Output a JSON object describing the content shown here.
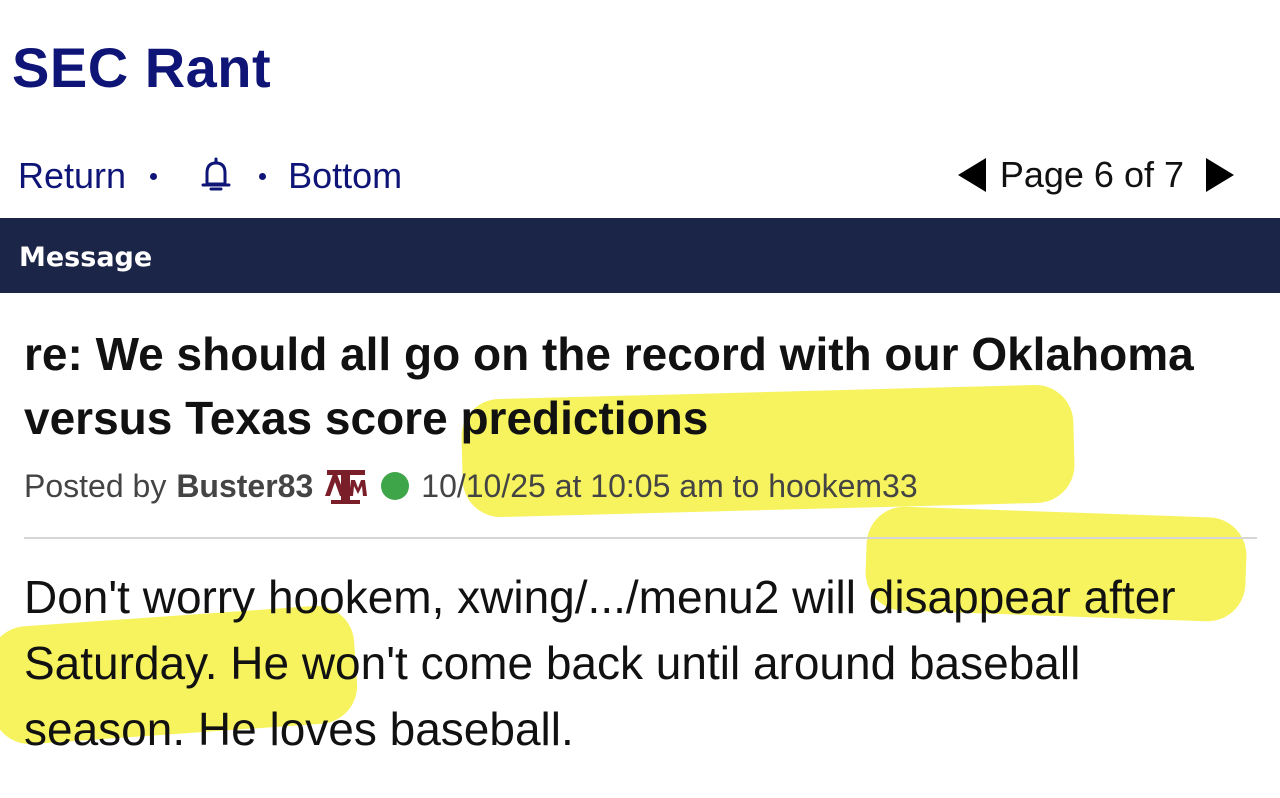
{
  "site": {
    "title": "SEC Rant"
  },
  "nav": {
    "return_label": "Return",
    "bell_icon": "bell-icon",
    "bottom_label": "Bottom"
  },
  "pager": {
    "label": "Page 6 of 7",
    "current_page": 6,
    "total_pages": 7
  },
  "section": {
    "label": "Message"
  },
  "post": {
    "title": "re: We should all go on the record with our Oklahoma versus Texas score predictions",
    "posted_by_label": "Posted by",
    "author": "Buster83",
    "team_logo": "texas-am-logo",
    "team_logo_text": "ATM",
    "online_status": "online",
    "timestamp": "10/10/25 at 10:05 am to hookem33",
    "body": "Don't worry hookem, xwing/.../menu2 will disappear after Saturday. He won't come back until around baseball season. He loves baseball."
  },
  "colors": {
    "brand": "#0e1577",
    "section_bar": "#1b2547",
    "online": "#3ea548",
    "highlight": "#f5f03a",
    "team_logo": "#7a1e2a"
  }
}
